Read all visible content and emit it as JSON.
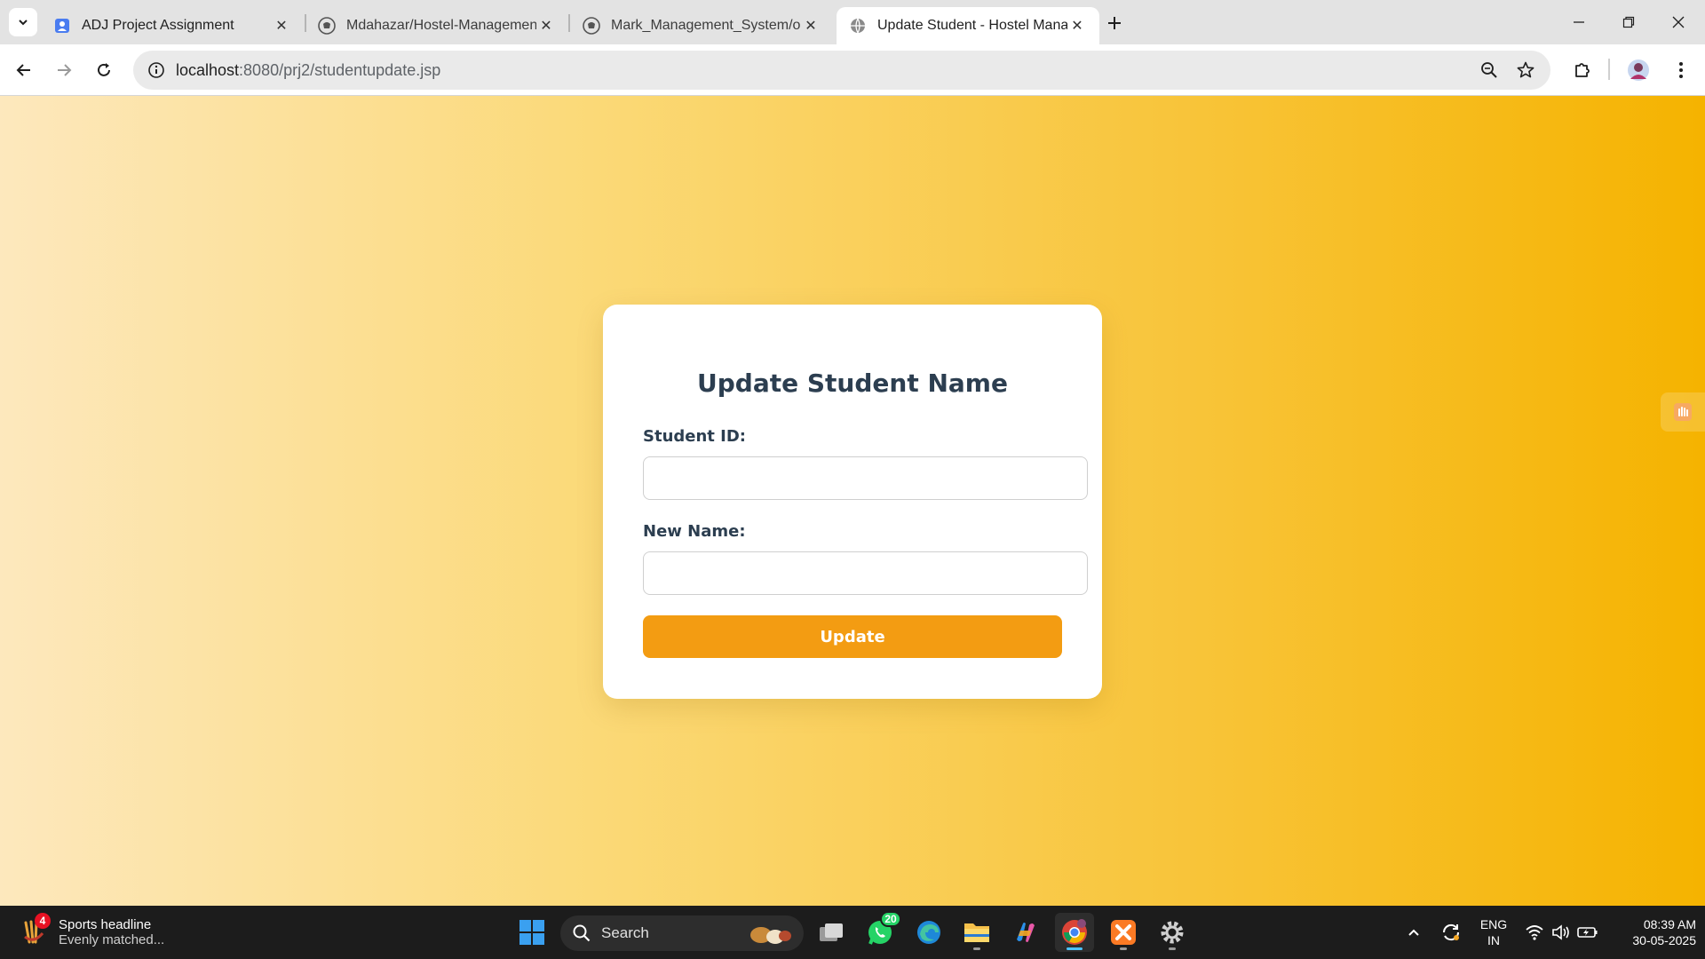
{
  "browser": {
    "tabs": [
      {
        "title": "ADJ Project Assignment",
        "favicon": "google-forms-icon",
        "active": false
      },
      {
        "title": "Mdahazar/Hostel-Management",
        "favicon": "github-icon",
        "active": false
      },
      {
        "title": "Mark_Management_System/out",
        "favicon": "github-icon",
        "active": false
      },
      {
        "title": "Update Student - Hostel Manag",
        "favicon": "globe-icon",
        "active": true
      }
    ],
    "url_host": "localhost",
    "url_path": ":8080/prj2/studentupdate.jsp"
  },
  "form": {
    "title": "Update Student Name",
    "student_id_label": "Student ID:",
    "student_id_value": "",
    "new_name_label": "New Name:",
    "new_name_value": "",
    "submit_label": "Update"
  },
  "taskbar": {
    "widget_badge": "4",
    "widget_title": "Sports headline",
    "widget_subtitle": "Evenly matched...",
    "search_label": "Search",
    "whatsapp_badge": "20",
    "language_line1": "ENG",
    "language_line2": "IN",
    "time": "08:39 AM",
    "date": "30-05-2025"
  },
  "colors": {
    "accent_button": "#f39c12",
    "heading_text": "#2c3e50",
    "gradient_start": "#fde8bd",
    "gradient_end": "#f5b300"
  }
}
